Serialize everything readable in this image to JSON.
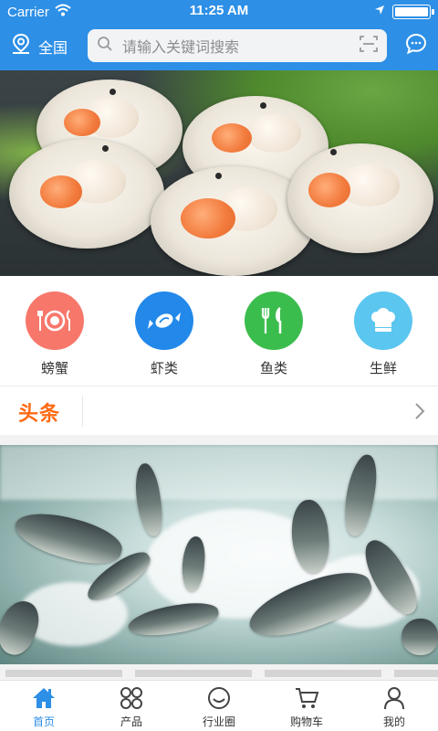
{
  "status_bar": {
    "carrier": "Carrier",
    "time": "11:25 AM"
  },
  "header": {
    "location_label": "全国",
    "search_placeholder": "请输入关键词搜索",
    "accent_color": "#2d8fe6"
  },
  "categories": [
    {
      "label": "螃蟹",
      "icon": "plate-cutlery-icon",
      "color": "#f7776b"
    },
    {
      "label": "虾类",
      "icon": "candy-icon",
      "color": "#2288ea"
    },
    {
      "label": "鱼类",
      "icon": "fork-knife-icon",
      "color": "#3bbd4d"
    },
    {
      "label": "生鲜",
      "icon": "chef-hat-icon",
      "color": "#5bc6ef"
    }
  ],
  "headline": {
    "title": "头条"
  },
  "tabbar": {
    "items": [
      {
        "label": "首页",
        "icon": "home-icon",
        "active": true
      },
      {
        "label": "产品",
        "icon": "grid-icon",
        "active": false
      },
      {
        "label": "行业圈",
        "icon": "smile-circle-icon",
        "active": false
      },
      {
        "label": "购物车",
        "icon": "cart-icon",
        "active": false
      },
      {
        "label": "我的",
        "icon": "user-icon",
        "active": false
      }
    ]
  }
}
